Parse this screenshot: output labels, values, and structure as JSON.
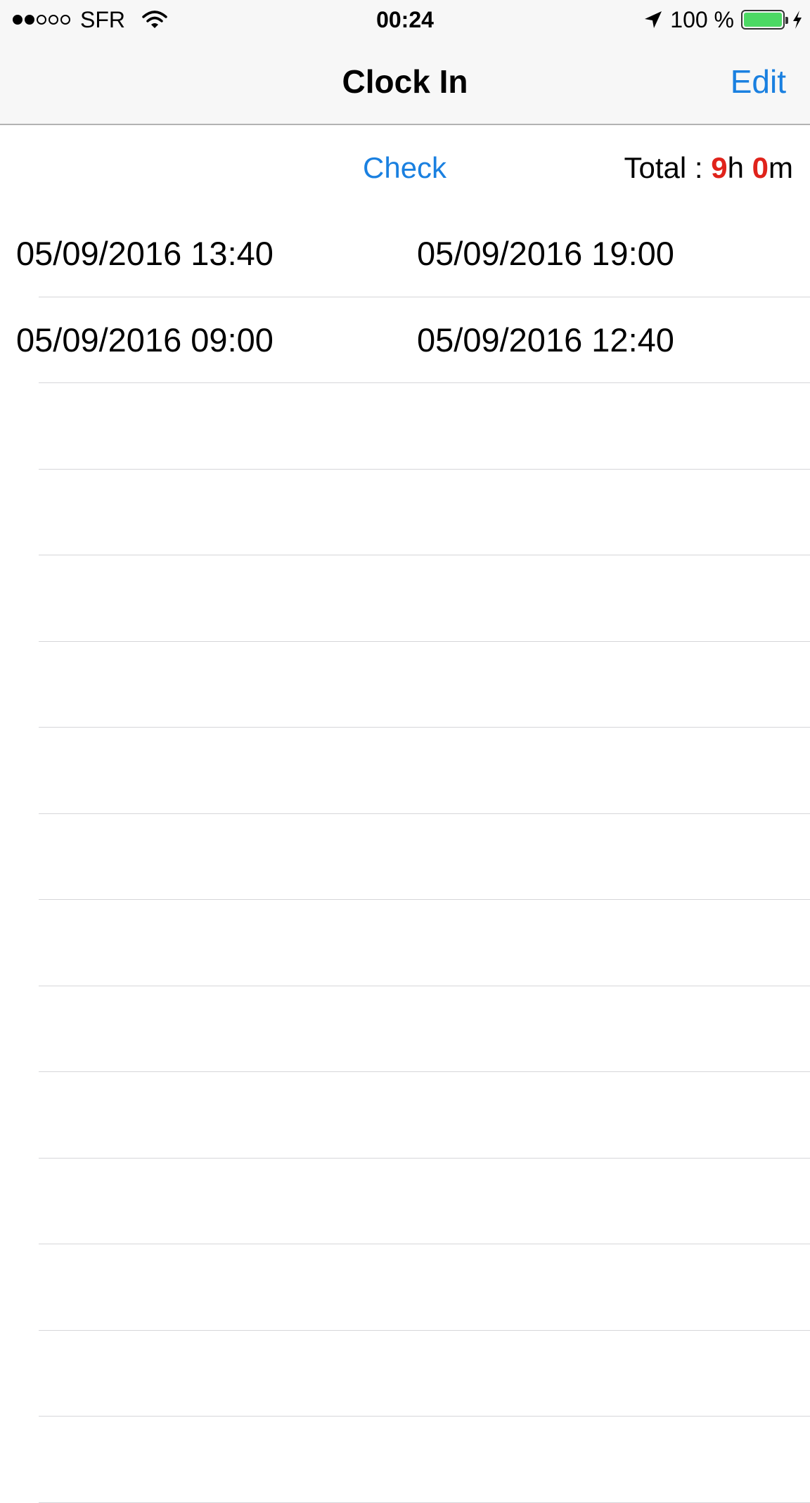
{
  "status_bar": {
    "signal_dots_filled": 2,
    "signal_dots_total": 5,
    "carrier": "SFR",
    "time": "00:24",
    "battery_text": "100 %",
    "battery_level": 1.0,
    "battery_color": "#4cd964",
    "icons": [
      "wifi-icon",
      "location-arrow-icon",
      "battery-icon",
      "charging-bolt-icon"
    ]
  },
  "nav": {
    "title": "Clock In",
    "edit_label": "Edit"
  },
  "header": {
    "check_label": "Check",
    "total_label": "Total : ",
    "total_hours": "9",
    "hours_unit": "h ",
    "total_minutes": "0",
    "minutes_unit": "m"
  },
  "entries": [
    {
      "in": "05/09/2016 13:40",
      "out": "05/09/2016 19:00"
    },
    {
      "in": "05/09/2016 09:00",
      "out": "05/09/2016 12:40"
    }
  ],
  "empty_rows": 13,
  "colors": {
    "accent": "#1a80e0",
    "total_highlight": "#e0231b",
    "bar_background": "#f7f7f7",
    "separator": "#d6d6d9"
  }
}
